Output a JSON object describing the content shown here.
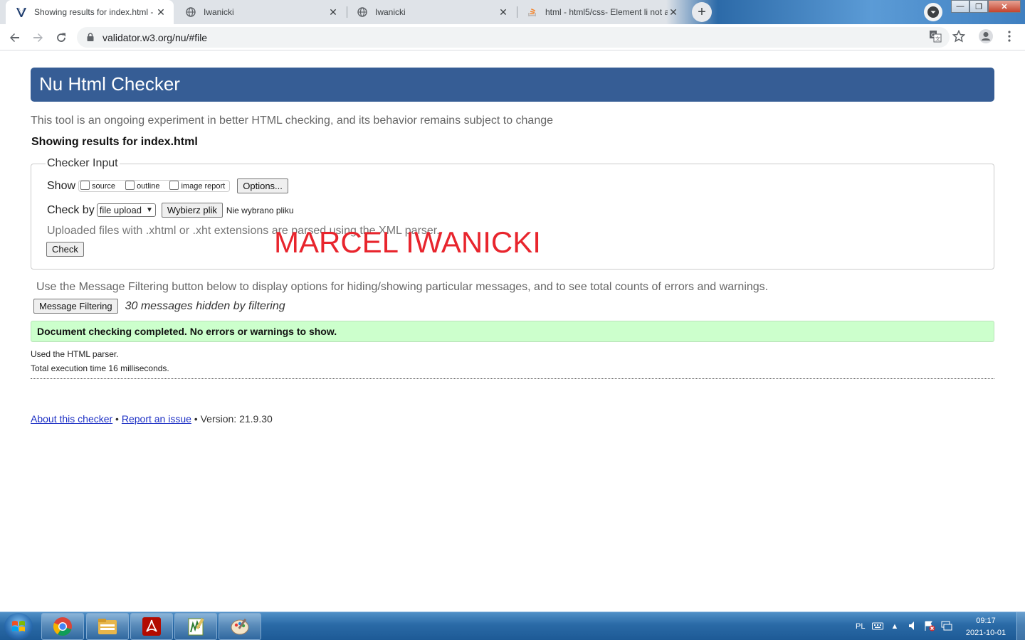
{
  "browser": {
    "tabs": [
      {
        "title": "Showing results for index.html - Nu",
        "icon": "validator-favicon",
        "active": true
      },
      {
        "title": "Iwanicki",
        "icon": "globe-icon",
        "active": false
      },
      {
        "title": "Iwanicki",
        "icon": "globe-icon",
        "active": false
      },
      {
        "title": "html - html5/css- Element li not al",
        "icon": "stackoverflow-icon",
        "active": false
      }
    ],
    "url": "validator.w3.org/nu/#file"
  },
  "page": {
    "header": "Nu Html Checker",
    "intro": "This tool is an ongoing experiment in better HTML checking, and its behavior remains subject to change",
    "results_title": "Showing results for index.html",
    "checker": {
      "legend": "Checker Input",
      "show_label": "Show",
      "show_options": [
        "source",
        "outline",
        "image report"
      ],
      "options_button": "Options...",
      "checkby_label": "Check by",
      "checkby_value": "file upload",
      "choose_file_button": "Wybierz plik",
      "no_file_text": "Nie wybrano pliku",
      "hint": "Uploaded files with .xhtml or .xht extensions are parsed using the XML parser.",
      "check_button": "Check"
    },
    "watermark": "MARCEL IWANICKI",
    "filter_help": "Use the Message Filtering button below to display options for hiding/showing particular messages, and to see total counts of errors and warnings.",
    "filter_button": "Message Filtering",
    "hidden_count": "30 messages hidden by filtering",
    "success_message": "Document checking completed. No errors or warnings to show.",
    "parser_info": "Used the HTML parser.",
    "execution_time": "Total execution time 16 milliseconds.",
    "footer": {
      "about_link": "About this checker",
      "sep1": " • ",
      "report_link": "Report an issue",
      "version": " • Version: 21.9.30"
    }
  },
  "taskbar": {
    "apps": [
      "chrome-icon",
      "file-explorer-icon",
      "acrobat-icon",
      "notepad-icon",
      "paint-icon"
    ],
    "language": "PL",
    "time": "09:17",
    "date": "2021-10-01"
  }
}
